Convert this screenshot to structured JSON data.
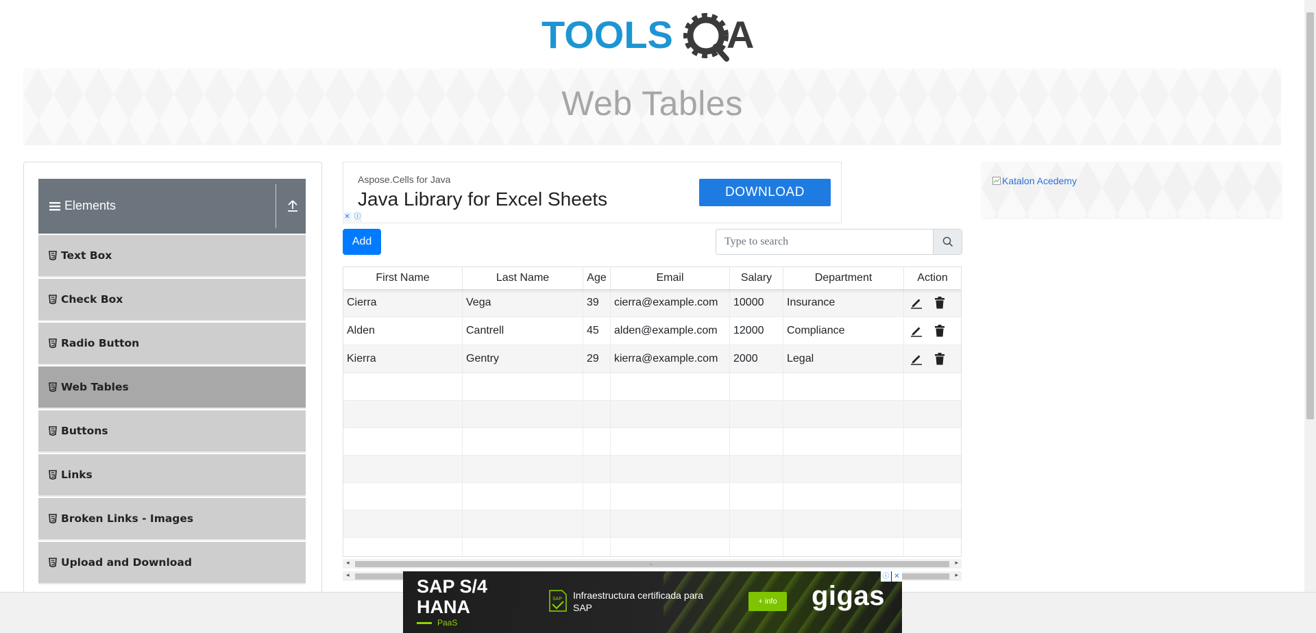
{
  "header": {
    "logo_text_1": "TOOLS",
    "logo_text_2": "QA",
    "page_title": "Web Tables"
  },
  "sidebar": {
    "group_title": "Elements",
    "items": [
      {
        "label": "Text Box"
      },
      {
        "label": "Check Box"
      },
      {
        "label": "Radio Button"
      },
      {
        "label": "Web Tables",
        "active": true
      },
      {
        "label": "Buttons"
      },
      {
        "label": "Links"
      },
      {
        "label": "Broken Links - Images"
      },
      {
        "label": "Upload and Download"
      }
    ]
  },
  "ad_top": {
    "small": "Aspose.Cells for Java",
    "big": "Java Library for Excel Sheets",
    "button": "DOWNLOAD"
  },
  "toolbar": {
    "add_label": "Add",
    "search_placeholder": "Type to search"
  },
  "table": {
    "headers": [
      "First Name",
      "Last Name",
      "Age",
      "Email",
      "Salary",
      "Department",
      "Action"
    ],
    "rows": [
      [
        "Cierra",
        "Vega",
        "39",
        "cierra@example.com",
        "10000",
        "Insurance"
      ],
      [
        "Alden",
        "Cantrell",
        "45",
        "alden@example.com",
        "12000",
        "Compliance"
      ],
      [
        "Kierra",
        "Gentry",
        "29",
        "kierra@example.com",
        "2000",
        "Legal"
      ]
    ]
  },
  "right_ad": {
    "alt_text": "Katalon Acedemy"
  },
  "bottom_ad": {
    "title_line1": "SAP S/4",
    "title_line2": "HANA",
    "tag": "PaaS",
    "text": "Infraestructura certificada para SAP",
    "button": "+ info",
    "brand": "gigas"
  },
  "colors": {
    "primary": "#007bff",
    "sidebar_header": "#6c757d",
    "sidebar_item": "#cecece",
    "sidebar_item_active": "#a8a8a8",
    "logo_blue": "#1d95d3",
    "logo_dark": "#3b3b3b"
  }
}
